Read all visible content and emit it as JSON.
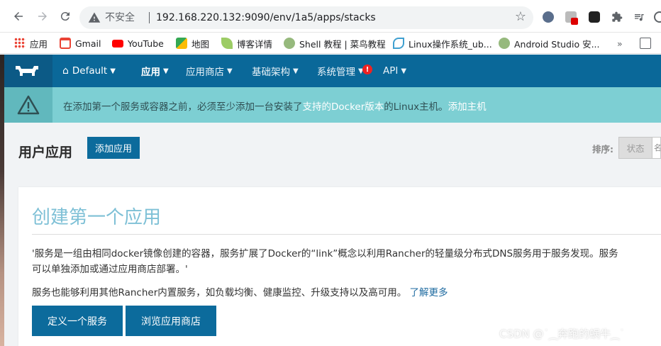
{
  "browser": {
    "insecure_label": "不安全",
    "url": "192.168.220.132:9090/env/1a5/apps/stacks",
    "bookmarks": [
      {
        "label": "应用",
        "icon": "apps-grid-icon",
        "color": "#4285f4"
      },
      {
        "label": "Gmail",
        "icon": "gmail-icon",
        "color": "#ea4335"
      },
      {
        "label": "YouTube",
        "icon": "youtube-icon",
        "color": "#ff0000"
      },
      {
        "label": "地图",
        "icon": "maps-icon",
        "color": "#34a853"
      },
      {
        "label": "博客详情",
        "icon": "leaf-icon",
        "color": "#8bc34a"
      },
      {
        "label": "Shell 教程 | 菜鸟教程",
        "icon": "runoob-icon",
        "color": "#96b97d"
      },
      {
        "label": "Linux操作系统_ub...",
        "icon": "linux-bookmark-icon",
        "color": "#40a0d0"
      },
      {
        "label": "Android Studio 安...",
        "icon": "runoob-icon",
        "color": "#96b97d"
      }
    ],
    "overflow_label": "»"
  },
  "header": {
    "env_label": "Default",
    "nav": [
      {
        "label": "应用",
        "active": true
      },
      {
        "label": "应用商店",
        "active": false
      },
      {
        "label": "基础架构",
        "active": false
      },
      {
        "label": "系统管理",
        "active": false
      },
      {
        "label": "API",
        "active": false
      }
    ],
    "alert_badge": "!"
  },
  "banner": {
    "text_before": "在添加第一个服务或容器之前，必须至少添加一台安装了",
    "link_docker": "支持的Docker版本",
    "text_middle": "的Linux主机。",
    "link_add_host": "添加主机"
  },
  "page": {
    "title": "用户应用",
    "add_app_button": "添加应用",
    "sort_label": "排序:",
    "sort_state": "状态",
    "sort_other": "名"
  },
  "card": {
    "title": "创建第一个应用",
    "paragraph1_line1": "'服务是一组由相同docker镜像创建的容器，服务扩展了Docker的“link”概念以利用Rancher的轻量级分布式DNS服务用于服务发现。服务",
    "paragraph1_line2": "可以单独添加或通过应用商店部署。'",
    "paragraph2": "服务也能够利用其他Rancher内置服务，如负载均衡、健康监控、升级支持以及高可用。",
    "learn_more": "了解更多",
    "btn_define_service": "定义一个服务",
    "btn_browse_catalog": "浏览应用商店"
  },
  "watermark": "CSDN @˙⁔奔跑的蜗牛⁔˙",
  "colors": {
    "header_bg": "#0a6899",
    "banner_bg": "#7dcfd3",
    "primary_button": "#0c6b9c",
    "card_title": "#7ec0d6"
  }
}
